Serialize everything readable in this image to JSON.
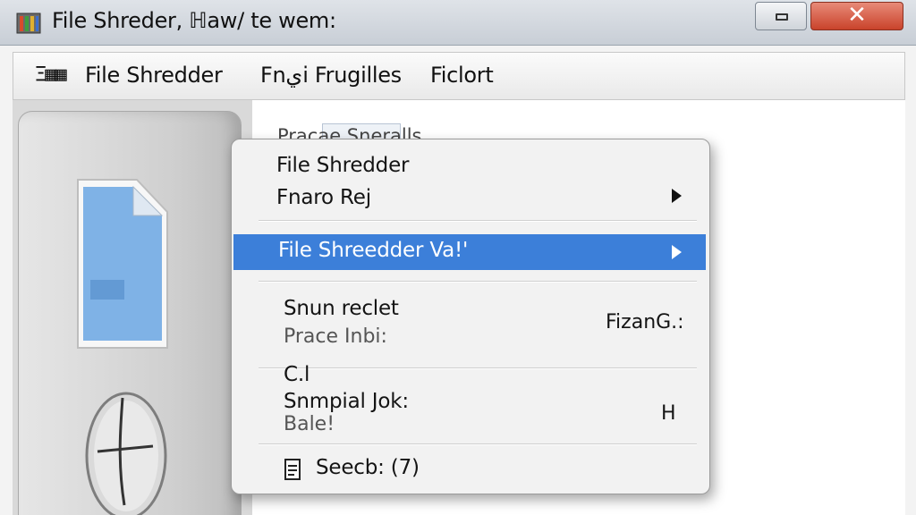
{
  "window": {
    "title": "File Shreder, ℍaw/ te wem:"
  },
  "menubar": {
    "glyph": "Ξ▦▦",
    "items": [
      "File Shredder",
      "Fnيi Frugilles",
      "Ficlort"
    ]
  },
  "background_panel": {
    "label": "Pracae Sneralls"
  },
  "context_menu": {
    "header_title": "File Shredder",
    "header_item": "Fnaro Rej",
    "highlighted_item": "File Shreedder  Va!'",
    "item_one_main": "Snun reclet",
    "item_one_sub": "Prace Inbi:",
    "item_one_shortcut": "FizanG.:",
    "item_two_top": "C.l",
    "item_two_main": "Snmpial Jok:",
    "item_two_sub": "Bale!",
    "item_two_shortcut": "H",
    "search_label": "Seecb: (7)"
  },
  "colors": {
    "highlight": "#3c7fd9",
    "close_button": "#c9432b"
  },
  "icons": [
    "app-icon",
    "minimize-icon",
    "close-icon",
    "document-icon",
    "mouse-icon",
    "submenu-arrow-icon",
    "search-icon"
  ]
}
